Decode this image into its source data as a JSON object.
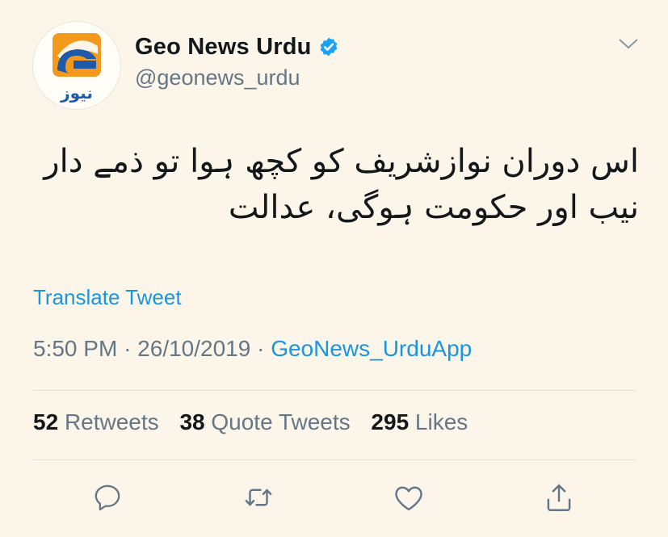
{
  "account": {
    "display_name": "Geo News Urdu",
    "handle": "@geonews_urdu",
    "verified": true,
    "avatar_logo_text": "نیوز"
  },
  "tweet": {
    "text": "اس دوران نوازشریف کو کچھ ہوا تو ذمے دار نیب اور حکومت ہوگی، عدالت",
    "translate_label": "Translate Tweet",
    "time": "5:50 PM",
    "date": "26/10/2019",
    "separator": "·",
    "source": "GeoNews_UrduApp"
  },
  "stats": {
    "retweets_count": "52",
    "retweets_label": "Retweets",
    "quote_tweets_count": "38",
    "quote_tweets_label": "Quote Tweets",
    "likes_count": "295",
    "likes_label": "Likes"
  },
  "actions": [
    "reply-icon",
    "retweet-icon",
    "like-icon",
    "share-icon"
  ],
  "colors": {
    "background": "#fbf5ea",
    "link": "#1b95e0",
    "secondary_text": "#657786",
    "primary_text": "#14171a",
    "verified_badge": "#1da1f2",
    "logo_orange": "#f39a1d",
    "logo_blue": "#1e5aa8"
  }
}
